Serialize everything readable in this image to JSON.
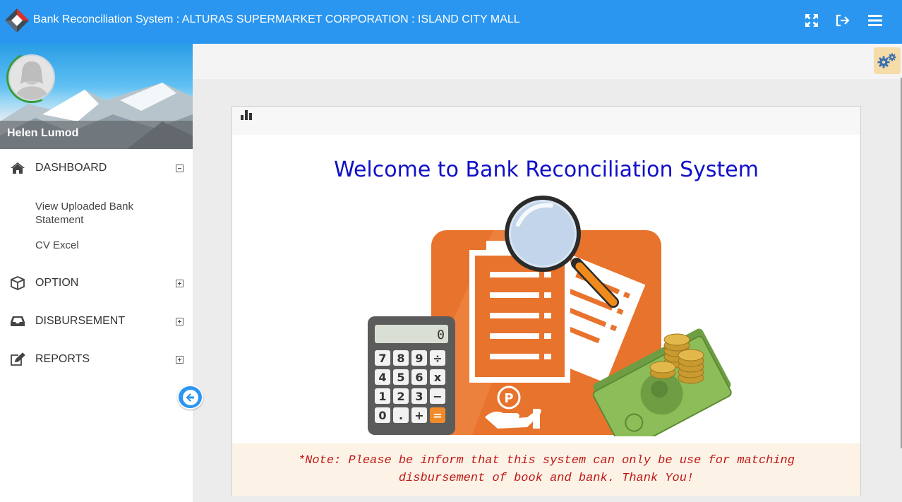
{
  "header": {
    "title": "Bank Reconciliation System : ALTURAS SUPERMARKET CORPORATION : ISLAND CITY MALL",
    "icons": [
      "fullscreen-icon",
      "logout-icon",
      "menu-icon"
    ]
  },
  "sidebar": {
    "user_name": "Helen Lumod",
    "items": [
      {
        "label": "DASHBOARD",
        "icon": "home-icon",
        "expanded": true,
        "children": [
          {
            "label": "View Uploaded Bank Statement"
          },
          {
            "label": "CV Excel"
          }
        ]
      },
      {
        "label": "OPTION",
        "icon": "cube-icon",
        "expanded": false
      },
      {
        "label": "DISBURSEMENT",
        "icon": "inbox-icon",
        "expanded": false
      },
      {
        "label": "REPORTS",
        "icon": "edit-icon",
        "expanded": false
      }
    ]
  },
  "main": {
    "panel_icon": "bar-chart-icon",
    "welcome": "Welcome to Bank Reconciliation System",
    "calculator_display": "0",
    "calculator_keys": [
      "7",
      "8",
      "9",
      "÷",
      "4",
      "5",
      "6",
      "x",
      "1",
      "2",
      "3",
      "−",
      "0",
      ".",
      "+",
      "="
    ],
    "coin_symbol": "P",
    "note": "*Note: Please be inform that this system can only be use for matching disbursement of book and bank. Thank You!"
  },
  "colors": {
    "topbar": "#2a96f0",
    "welcome_text": "#1010c8",
    "note_text": "#c01818",
    "note_bg": "#fcf3e6",
    "settings_bg": "#f6dca8",
    "illustration_orange": "#e8732d"
  }
}
